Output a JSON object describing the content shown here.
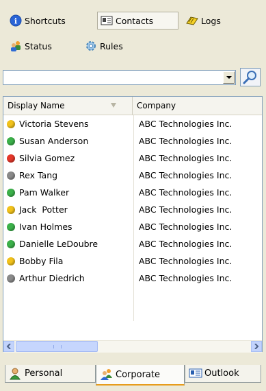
{
  "toolbar": {
    "shortcuts": "Shortcuts",
    "contacts": "Contacts",
    "logs": "Logs",
    "status": "Status",
    "rules": "Rules"
  },
  "search": {
    "value": ""
  },
  "grid": {
    "headers": {
      "name": "Display Name",
      "company": "Company"
    },
    "rows": [
      {
        "name": "Victoria Stevens",
        "company": "ABC Technologies Inc.",
        "status": "away",
        "color": "#f2c21b"
      },
      {
        "name": "Susan Anderson",
        "company": "ABC Technologies Inc.",
        "status": "online",
        "color": "#3cb14a"
      },
      {
        "name": "Silvia Gomez",
        "company": "ABC Technologies Inc.",
        "status": "busy",
        "color": "#e5372a"
      },
      {
        "name": "Rex Tang",
        "company": "ABC Technologies Inc.",
        "status": "offline",
        "color": "#8a8a8a"
      },
      {
        "name": "Pam Walker",
        "company": "ABC Technologies Inc.",
        "status": "online",
        "color": "#3cb14a"
      },
      {
        "name": "Jack  Potter",
        "company": "ABC Technologies Inc.",
        "status": "away",
        "color": "#f2c21b"
      },
      {
        "name": "Ivan Holmes",
        "company": "ABC Technologies Inc.",
        "status": "online",
        "color": "#3cb14a"
      },
      {
        "name": "Danielle LeDoubre",
        "company": "ABC Technologies Inc.",
        "status": "online",
        "color": "#3cb14a"
      },
      {
        "name": "Bobby Fila",
        "company": "ABC Technologies Inc.",
        "status": "away",
        "color": "#f2c21b"
      },
      {
        "name": "Arthur Diedrich",
        "company": "ABC Technologies Inc.",
        "status": "offline",
        "color": "#8a8a8a"
      }
    ]
  },
  "tabs": {
    "personal": "Personal",
    "corporate": "Corporate",
    "outlook": "Outlook"
  }
}
